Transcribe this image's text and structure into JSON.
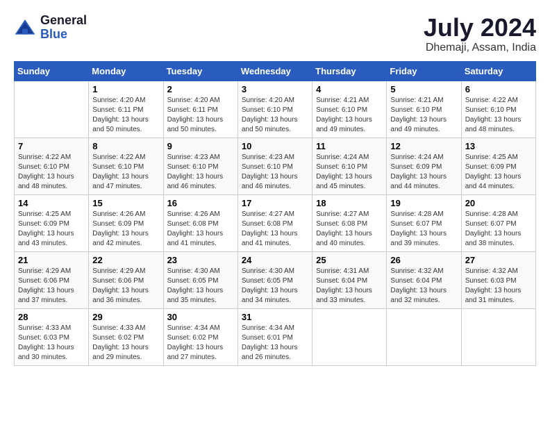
{
  "header": {
    "logo_general": "General",
    "logo_blue": "Blue",
    "month_year": "July 2024",
    "location": "Dhemaji, Assam, India"
  },
  "calendar": {
    "days_of_week": [
      "Sunday",
      "Monday",
      "Tuesday",
      "Wednesday",
      "Thursday",
      "Friday",
      "Saturday"
    ],
    "weeks": [
      [
        {
          "day": "",
          "sunrise": "",
          "sunset": "",
          "daylight": ""
        },
        {
          "day": "1",
          "sunrise": "Sunrise: 4:20 AM",
          "sunset": "Sunset: 6:11 PM",
          "daylight": "Daylight: 13 hours and 50 minutes."
        },
        {
          "day": "2",
          "sunrise": "Sunrise: 4:20 AM",
          "sunset": "Sunset: 6:11 PM",
          "daylight": "Daylight: 13 hours and 50 minutes."
        },
        {
          "day": "3",
          "sunrise": "Sunrise: 4:20 AM",
          "sunset": "Sunset: 6:10 PM",
          "daylight": "Daylight: 13 hours and 50 minutes."
        },
        {
          "day": "4",
          "sunrise": "Sunrise: 4:21 AM",
          "sunset": "Sunset: 6:10 PM",
          "daylight": "Daylight: 13 hours and 49 minutes."
        },
        {
          "day": "5",
          "sunrise": "Sunrise: 4:21 AM",
          "sunset": "Sunset: 6:10 PM",
          "daylight": "Daylight: 13 hours and 49 minutes."
        },
        {
          "day": "6",
          "sunrise": "Sunrise: 4:22 AM",
          "sunset": "Sunset: 6:10 PM",
          "daylight": "Daylight: 13 hours and 48 minutes."
        }
      ],
      [
        {
          "day": "7",
          "sunrise": "Sunrise: 4:22 AM",
          "sunset": "Sunset: 6:10 PM",
          "daylight": "Daylight: 13 hours and 48 minutes."
        },
        {
          "day": "8",
          "sunrise": "Sunrise: 4:22 AM",
          "sunset": "Sunset: 6:10 PM",
          "daylight": "Daylight: 13 hours and 47 minutes."
        },
        {
          "day": "9",
          "sunrise": "Sunrise: 4:23 AM",
          "sunset": "Sunset: 6:10 PM",
          "daylight": "Daylight: 13 hours and 46 minutes."
        },
        {
          "day": "10",
          "sunrise": "Sunrise: 4:23 AM",
          "sunset": "Sunset: 6:10 PM",
          "daylight": "Daylight: 13 hours and 46 minutes."
        },
        {
          "day": "11",
          "sunrise": "Sunrise: 4:24 AM",
          "sunset": "Sunset: 6:10 PM",
          "daylight": "Daylight: 13 hours and 45 minutes."
        },
        {
          "day": "12",
          "sunrise": "Sunrise: 4:24 AM",
          "sunset": "Sunset: 6:09 PM",
          "daylight": "Daylight: 13 hours and 44 minutes."
        },
        {
          "day": "13",
          "sunrise": "Sunrise: 4:25 AM",
          "sunset": "Sunset: 6:09 PM",
          "daylight": "Daylight: 13 hours and 44 minutes."
        }
      ],
      [
        {
          "day": "14",
          "sunrise": "Sunrise: 4:25 AM",
          "sunset": "Sunset: 6:09 PM",
          "daylight": "Daylight: 13 hours and 43 minutes."
        },
        {
          "day": "15",
          "sunrise": "Sunrise: 4:26 AM",
          "sunset": "Sunset: 6:09 PM",
          "daylight": "Daylight: 13 hours and 42 minutes."
        },
        {
          "day": "16",
          "sunrise": "Sunrise: 4:26 AM",
          "sunset": "Sunset: 6:08 PM",
          "daylight": "Daylight: 13 hours and 41 minutes."
        },
        {
          "day": "17",
          "sunrise": "Sunrise: 4:27 AM",
          "sunset": "Sunset: 6:08 PM",
          "daylight": "Daylight: 13 hours and 41 minutes."
        },
        {
          "day": "18",
          "sunrise": "Sunrise: 4:27 AM",
          "sunset": "Sunset: 6:08 PM",
          "daylight": "Daylight: 13 hours and 40 minutes."
        },
        {
          "day": "19",
          "sunrise": "Sunrise: 4:28 AM",
          "sunset": "Sunset: 6:07 PM",
          "daylight": "Daylight: 13 hours and 39 minutes."
        },
        {
          "day": "20",
          "sunrise": "Sunrise: 4:28 AM",
          "sunset": "Sunset: 6:07 PM",
          "daylight": "Daylight: 13 hours and 38 minutes."
        }
      ],
      [
        {
          "day": "21",
          "sunrise": "Sunrise: 4:29 AM",
          "sunset": "Sunset: 6:06 PM",
          "daylight": "Daylight: 13 hours and 37 minutes."
        },
        {
          "day": "22",
          "sunrise": "Sunrise: 4:29 AM",
          "sunset": "Sunset: 6:06 PM",
          "daylight": "Daylight: 13 hours and 36 minutes."
        },
        {
          "day": "23",
          "sunrise": "Sunrise: 4:30 AM",
          "sunset": "Sunset: 6:05 PM",
          "daylight": "Daylight: 13 hours and 35 minutes."
        },
        {
          "day": "24",
          "sunrise": "Sunrise: 4:30 AM",
          "sunset": "Sunset: 6:05 PM",
          "daylight": "Daylight: 13 hours and 34 minutes."
        },
        {
          "day": "25",
          "sunrise": "Sunrise: 4:31 AM",
          "sunset": "Sunset: 6:04 PM",
          "daylight": "Daylight: 13 hours and 33 minutes."
        },
        {
          "day": "26",
          "sunrise": "Sunrise: 4:32 AM",
          "sunset": "Sunset: 6:04 PM",
          "daylight": "Daylight: 13 hours and 32 minutes."
        },
        {
          "day": "27",
          "sunrise": "Sunrise: 4:32 AM",
          "sunset": "Sunset: 6:03 PM",
          "daylight": "Daylight: 13 hours and 31 minutes."
        }
      ],
      [
        {
          "day": "28",
          "sunrise": "Sunrise: 4:33 AM",
          "sunset": "Sunset: 6:03 PM",
          "daylight": "Daylight: 13 hours and 30 minutes."
        },
        {
          "day": "29",
          "sunrise": "Sunrise: 4:33 AM",
          "sunset": "Sunset: 6:02 PM",
          "daylight": "Daylight: 13 hours and 29 minutes."
        },
        {
          "day": "30",
          "sunrise": "Sunrise: 4:34 AM",
          "sunset": "Sunset: 6:02 PM",
          "daylight": "Daylight: 13 hours and 27 minutes."
        },
        {
          "day": "31",
          "sunrise": "Sunrise: 4:34 AM",
          "sunset": "Sunset: 6:01 PM",
          "daylight": "Daylight: 13 hours and 26 minutes."
        },
        {
          "day": "",
          "sunrise": "",
          "sunset": "",
          "daylight": ""
        },
        {
          "day": "",
          "sunrise": "",
          "sunset": "",
          "daylight": ""
        },
        {
          "day": "",
          "sunrise": "",
          "sunset": "",
          "daylight": ""
        }
      ]
    ]
  }
}
